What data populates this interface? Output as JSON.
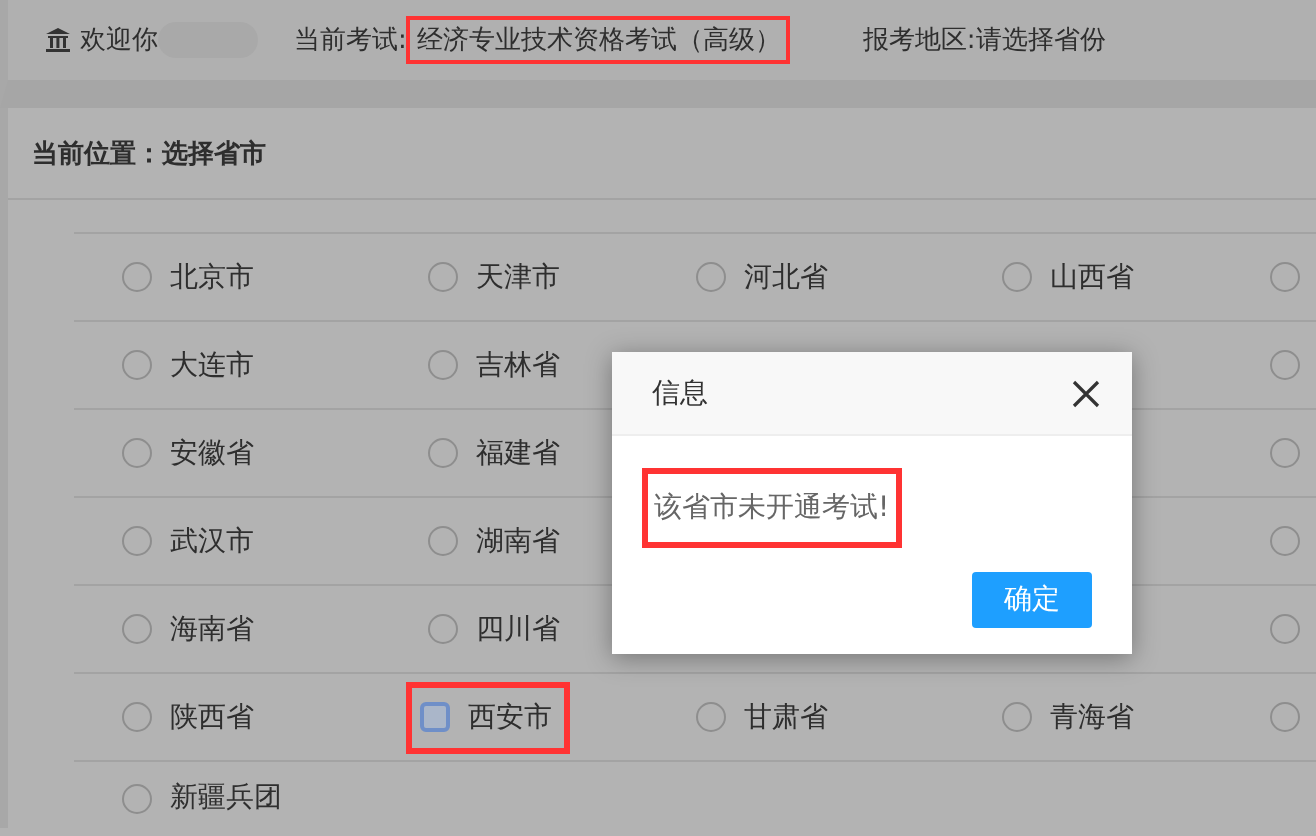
{
  "header": {
    "welcome": "欢迎你",
    "exam_label": "当前考试:",
    "exam_name": "经济专业技术资格考试（高级）",
    "exam_highlighted": true,
    "region_label": "报考地区:",
    "region_value": "请选择省份"
  },
  "breadcrumb": "当前位置：选择省市",
  "regions": [
    [
      {
        "label": "北京市",
        "selected": false,
        "focused": false
      },
      {
        "label": "天津市",
        "selected": false,
        "focused": false
      },
      {
        "label": "河北省",
        "selected": false,
        "focused": false
      },
      {
        "label": "山西省",
        "selected": false,
        "focused": false
      },
      {
        "selected": false,
        "focused": false
      }
    ],
    [
      {
        "label": "大连市",
        "selected": false,
        "focused": false
      },
      {
        "label": "吉林省",
        "selected": false,
        "focused": false
      },
      {
        "selected": false,
        "focused": false
      }
    ],
    [
      {
        "label": "安徽省",
        "selected": false,
        "focused": false
      },
      {
        "label": "福建省",
        "selected": false,
        "focused": false
      },
      {
        "selected": false,
        "focused": false
      }
    ],
    [
      {
        "label": "武汉市",
        "selected": false,
        "focused": false
      },
      {
        "label": "湖南省",
        "selected": false,
        "focused": false
      },
      {
        "selected": false,
        "focused": false
      }
    ],
    [
      {
        "label": "海南省",
        "selected": false,
        "focused": false
      },
      {
        "label": "四川省",
        "selected": false,
        "focused": false
      },
      {
        "selected": false,
        "focused": false
      }
    ],
    [
      {
        "label": "陕西省",
        "selected": false,
        "focused": false
      },
      {
        "label": "西安市",
        "selected": false,
        "focused": true,
        "highlighted": true
      },
      {
        "label": "甘肃省",
        "selected": false,
        "focused": false
      },
      {
        "label": "青海省",
        "selected": false,
        "focused": false
      },
      {
        "selected": false,
        "focused": false
      }
    ],
    [
      {
        "label": "新疆兵团",
        "selected": false,
        "focused": false
      }
    ]
  ],
  "dialog": {
    "title": "信息",
    "message": "该省市未开通考试!",
    "message_highlighted": true,
    "button": "确定"
  }
}
